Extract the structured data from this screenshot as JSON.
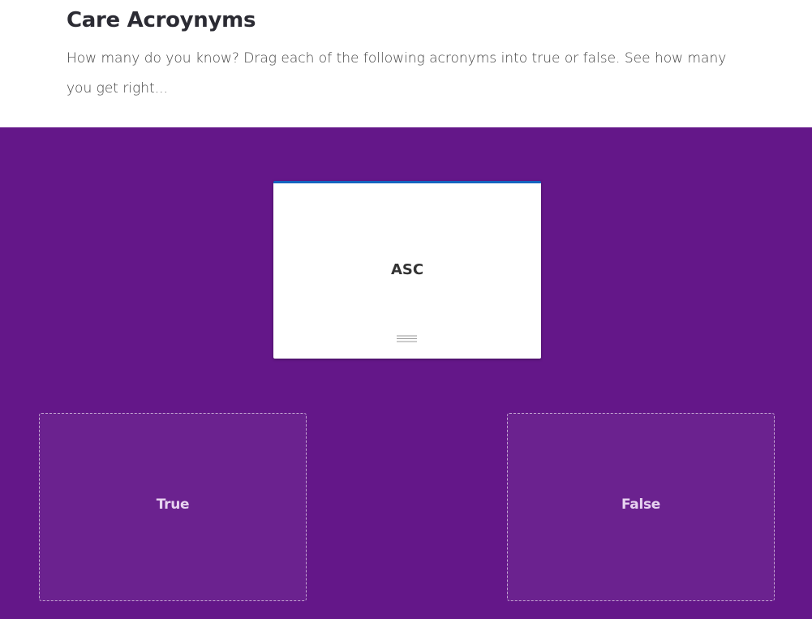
{
  "header": {
    "title": "Care Acroynyms",
    "description": "How many do you know? Drag each of the following acronyms into true or false. See how many you get right..."
  },
  "game": {
    "background_color": "#641789",
    "card": {
      "label": "ASC",
      "accent_color": "#1565c0",
      "handle_icon": "drag-handle-icon"
    },
    "drop_zones": [
      {
        "label": "True"
      },
      {
        "label": "False"
      }
    ]
  }
}
